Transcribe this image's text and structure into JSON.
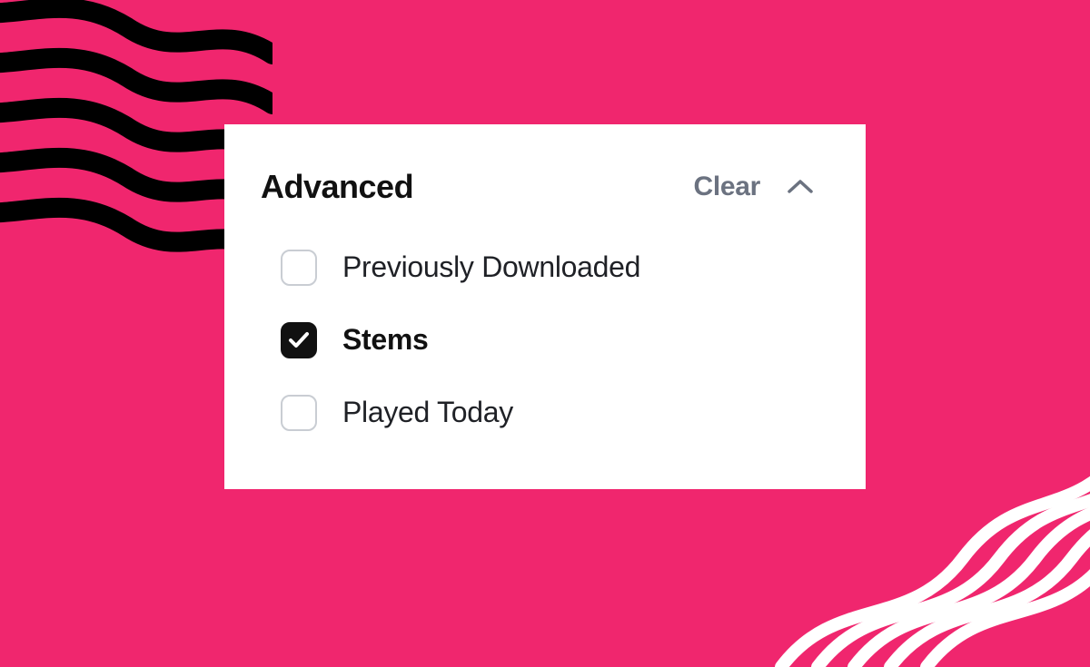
{
  "panel": {
    "title": "Advanced",
    "clear_label": "Clear"
  },
  "options": [
    {
      "label": "Previously Downloaded",
      "checked": false
    },
    {
      "label": "Stems",
      "checked": true
    },
    {
      "label": "Played Today",
      "checked": false
    }
  ],
  "colors": {
    "background": "#f0266e",
    "card": "#ffffff",
    "text": "#111111",
    "muted": "#6b7280",
    "checkbox_border": "#c9cdd3"
  }
}
